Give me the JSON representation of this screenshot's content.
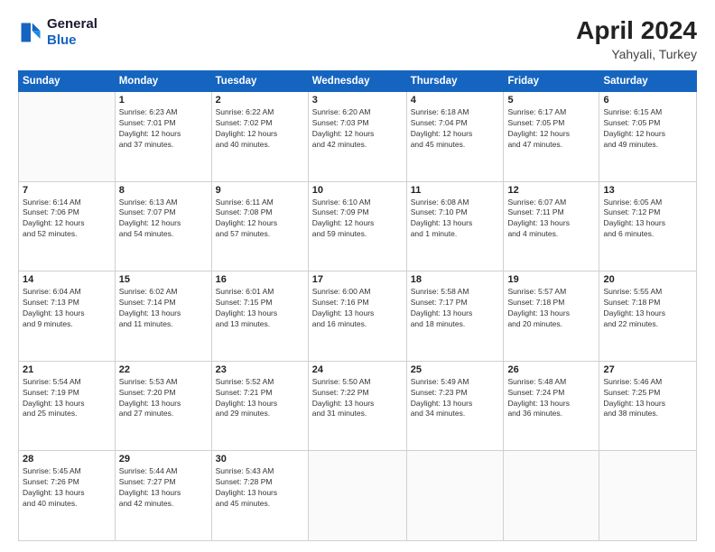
{
  "logo": {
    "line1": "General",
    "line2": "Blue"
  },
  "title": "April 2024",
  "location": "Yahyali, Turkey",
  "days_of_week": [
    "Sunday",
    "Monday",
    "Tuesday",
    "Wednesday",
    "Thursday",
    "Friday",
    "Saturday"
  ],
  "weeks": [
    [
      {
        "day": "",
        "info": ""
      },
      {
        "day": "1",
        "info": "Sunrise: 6:23 AM\nSunset: 7:01 PM\nDaylight: 12 hours\nand 37 minutes."
      },
      {
        "day": "2",
        "info": "Sunrise: 6:22 AM\nSunset: 7:02 PM\nDaylight: 12 hours\nand 40 minutes."
      },
      {
        "day": "3",
        "info": "Sunrise: 6:20 AM\nSunset: 7:03 PM\nDaylight: 12 hours\nand 42 minutes."
      },
      {
        "day": "4",
        "info": "Sunrise: 6:18 AM\nSunset: 7:04 PM\nDaylight: 12 hours\nand 45 minutes."
      },
      {
        "day": "5",
        "info": "Sunrise: 6:17 AM\nSunset: 7:05 PM\nDaylight: 12 hours\nand 47 minutes."
      },
      {
        "day": "6",
        "info": "Sunrise: 6:15 AM\nSunset: 7:05 PM\nDaylight: 12 hours\nand 49 minutes."
      }
    ],
    [
      {
        "day": "7",
        "info": "Sunrise: 6:14 AM\nSunset: 7:06 PM\nDaylight: 12 hours\nand 52 minutes."
      },
      {
        "day": "8",
        "info": "Sunrise: 6:13 AM\nSunset: 7:07 PM\nDaylight: 12 hours\nand 54 minutes."
      },
      {
        "day": "9",
        "info": "Sunrise: 6:11 AM\nSunset: 7:08 PM\nDaylight: 12 hours\nand 57 minutes."
      },
      {
        "day": "10",
        "info": "Sunrise: 6:10 AM\nSunset: 7:09 PM\nDaylight: 12 hours\nand 59 minutes."
      },
      {
        "day": "11",
        "info": "Sunrise: 6:08 AM\nSunset: 7:10 PM\nDaylight: 13 hours\nand 1 minute."
      },
      {
        "day": "12",
        "info": "Sunrise: 6:07 AM\nSunset: 7:11 PM\nDaylight: 13 hours\nand 4 minutes."
      },
      {
        "day": "13",
        "info": "Sunrise: 6:05 AM\nSunset: 7:12 PM\nDaylight: 13 hours\nand 6 minutes."
      }
    ],
    [
      {
        "day": "14",
        "info": "Sunrise: 6:04 AM\nSunset: 7:13 PM\nDaylight: 13 hours\nand 9 minutes."
      },
      {
        "day": "15",
        "info": "Sunrise: 6:02 AM\nSunset: 7:14 PM\nDaylight: 13 hours\nand 11 minutes."
      },
      {
        "day": "16",
        "info": "Sunrise: 6:01 AM\nSunset: 7:15 PM\nDaylight: 13 hours\nand 13 minutes."
      },
      {
        "day": "17",
        "info": "Sunrise: 6:00 AM\nSunset: 7:16 PM\nDaylight: 13 hours\nand 16 minutes."
      },
      {
        "day": "18",
        "info": "Sunrise: 5:58 AM\nSunset: 7:17 PM\nDaylight: 13 hours\nand 18 minutes."
      },
      {
        "day": "19",
        "info": "Sunrise: 5:57 AM\nSunset: 7:18 PM\nDaylight: 13 hours\nand 20 minutes."
      },
      {
        "day": "20",
        "info": "Sunrise: 5:55 AM\nSunset: 7:18 PM\nDaylight: 13 hours\nand 22 minutes."
      }
    ],
    [
      {
        "day": "21",
        "info": "Sunrise: 5:54 AM\nSunset: 7:19 PM\nDaylight: 13 hours\nand 25 minutes."
      },
      {
        "day": "22",
        "info": "Sunrise: 5:53 AM\nSunset: 7:20 PM\nDaylight: 13 hours\nand 27 minutes."
      },
      {
        "day": "23",
        "info": "Sunrise: 5:52 AM\nSunset: 7:21 PM\nDaylight: 13 hours\nand 29 minutes."
      },
      {
        "day": "24",
        "info": "Sunrise: 5:50 AM\nSunset: 7:22 PM\nDaylight: 13 hours\nand 31 minutes."
      },
      {
        "day": "25",
        "info": "Sunrise: 5:49 AM\nSunset: 7:23 PM\nDaylight: 13 hours\nand 34 minutes."
      },
      {
        "day": "26",
        "info": "Sunrise: 5:48 AM\nSunset: 7:24 PM\nDaylight: 13 hours\nand 36 minutes."
      },
      {
        "day": "27",
        "info": "Sunrise: 5:46 AM\nSunset: 7:25 PM\nDaylight: 13 hours\nand 38 minutes."
      }
    ],
    [
      {
        "day": "28",
        "info": "Sunrise: 5:45 AM\nSunset: 7:26 PM\nDaylight: 13 hours\nand 40 minutes."
      },
      {
        "day": "29",
        "info": "Sunrise: 5:44 AM\nSunset: 7:27 PM\nDaylight: 13 hours\nand 42 minutes."
      },
      {
        "day": "30",
        "info": "Sunrise: 5:43 AM\nSunset: 7:28 PM\nDaylight: 13 hours\nand 45 minutes."
      },
      {
        "day": "",
        "info": ""
      },
      {
        "day": "",
        "info": ""
      },
      {
        "day": "",
        "info": ""
      },
      {
        "day": "",
        "info": ""
      }
    ]
  ]
}
